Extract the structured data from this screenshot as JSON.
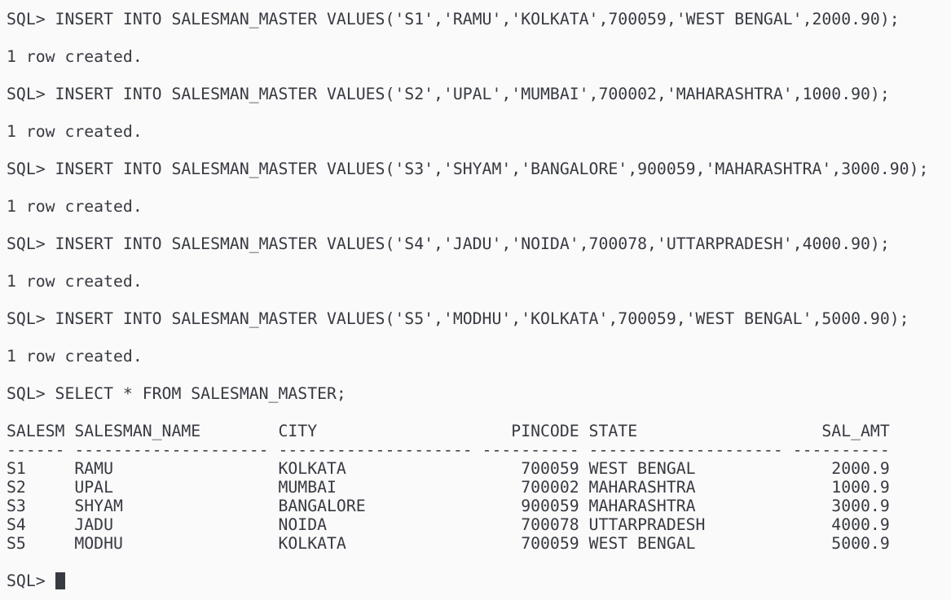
{
  "terminal": {
    "prompt": "SQL> ",
    "blocks": [
      {
        "type": "command",
        "text": "INSERT INTO SALESMAN_MASTER VALUES('S1','RAMU','KOLKATA',700059,'WEST BENGAL',2000.90);"
      },
      {
        "type": "output",
        "text": "1 row created."
      },
      {
        "type": "command",
        "text": "INSERT INTO SALESMAN_MASTER VALUES('S2','UPAL','MUMBAI',700002,'MAHARASHTRA',1000.90);"
      },
      {
        "type": "output",
        "text": "1 row created."
      },
      {
        "type": "command",
        "text": "INSERT INTO SALESMAN_MASTER VALUES('S3','SHYAM','BANGALORE',900059,'MAHARASHTRA',3000.90);"
      },
      {
        "type": "output",
        "text": "1 row created."
      },
      {
        "type": "command",
        "text": "INSERT INTO SALESMAN_MASTER VALUES('S4','JADU','NOIDA',700078,'UTTARPRADESH',4000.90);"
      },
      {
        "type": "output",
        "text": "1 row created."
      },
      {
        "type": "command",
        "text": "INSERT INTO SALESMAN_MASTER VALUES('S5','MODHU','KOLKATA',700059,'WEST BENGAL',5000.90);"
      },
      {
        "type": "output",
        "text": "1 row created."
      },
      {
        "type": "command",
        "text": "SELECT * FROM SALESMAN_MASTER;"
      }
    ],
    "result": {
      "header": "SALESM SALESMAN_NAME        CITY                    PINCODE STATE                   SAL_AMT",
      "separator": "------ -------------------- -------------------- ---------- -------------------- ----------",
      "rows": [
        "S1     RAMU                 KOLKATA                  700059 WEST BENGAL              2000.9",
        "S2     UPAL                 MUMBAI                   700002 MAHARASHTRA              1000.9",
        "S3     SHYAM                BANGALORE                900059 MAHARASHTRA              3000.9",
        "S4     JADU                 NOIDA                    700078 UTTARPRADESH             4000.9",
        "S5     MODHU                KOLKATA                  700059 WEST BENGAL              5000.9"
      ]
    },
    "colors": {
      "background": "#fafafa",
      "text": "#383a42"
    }
  }
}
